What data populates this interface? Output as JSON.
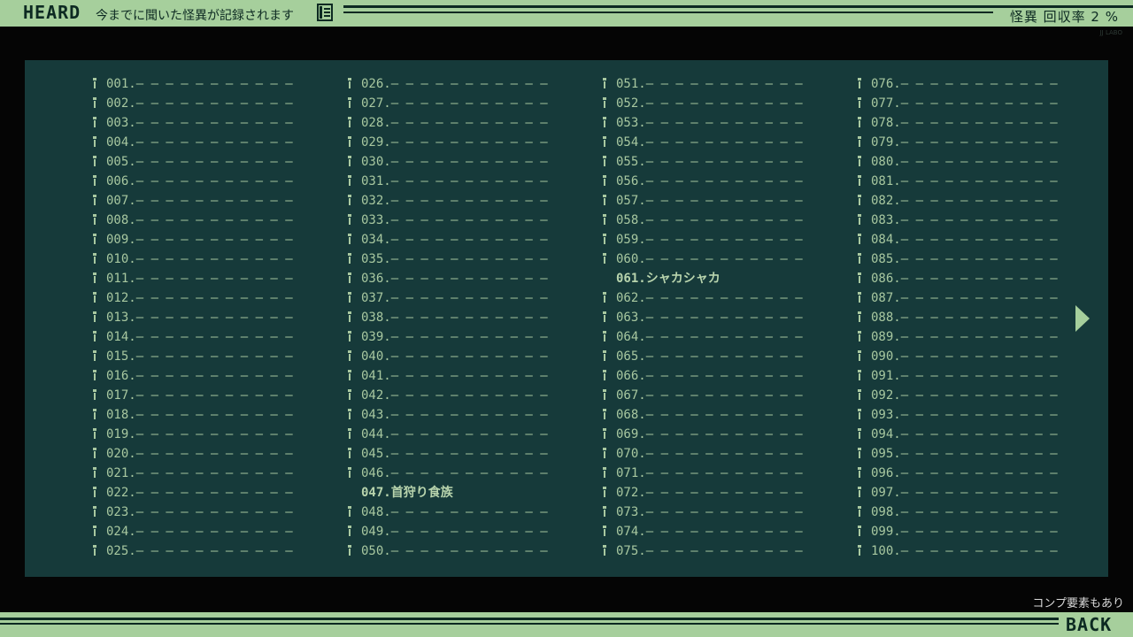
{
  "header": {
    "title": "HEARD",
    "subtitle": "今までに聞いた怪異が記録されます",
    "icon": "document-icon",
    "rate_label": "怪異 回収率 2 %"
  },
  "studio_credit": "JJ LABO",
  "colors": {
    "bar": "#a6cf9c",
    "panel": "#163a3a",
    "text": "#a8c8a0",
    "dark": "#0d2a22"
  },
  "entries": [
    {
      "num": "001.",
      "name": "",
      "locked": true
    },
    {
      "num": "002.",
      "name": "",
      "locked": true
    },
    {
      "num": "003.",
      "name": "",
      "locked": true
    },
    {
      "num": "004.",
      "name": "",
      "locked": true
    },
    {
      "num": "005.",
      "name": "",
      "locked": true
    },
    {
      "num": "006.",
      "name": "",
      "locked": true
    },
    {
      "num": "007.",
      "name": "",
      "locked": true
    },
    {
      "num": "008.",
      "name": "",
      "locked": true
    },
    {
      "num": "009.",
      "name": "",
      "locked": true
    },
    {
      "num": "010.",
      "name": "",
      "locked": true
    },
    {
      "num": "011.",
      "name": "",
      "locked": true
    },
    {
      "num": "012.",
      "name": "",
      "locked": true
    },
    {
      "num": "013.",
      "name": "",
      "locked": true
    },
    {
      "num": "014.",
      "name": "",
      "locked": true
    },
    {
      "num": "015.",
      "name": "",
      "locked": true
    },
    {
      "num": "016.",
      "name": "",
      "locked": true
    },
    {
      "num": "017.",
      "name": "",
      "locked": true
    },
    {
      "num": "018.",
      "name": "",
      "locked": true
    },
    {
      "num": "019.",
      "name": "",
      "locked": true
    },
    {
      "num": "020.",
      "name": "",
      "locked": true
    },
    {
      "num": "021.",
      "name": "",
      "locked": true
    },
    {
      "num": "022.",
      "name": "",
      "locked": true
    },
    {
      "num": "023.",
      "name": "",
      "locked": true
    },
    {
      "num": "024.",
      "name": "",
      "locked": true
    },
    {
      "num": "025.",
      "name": "",
      "locked": true
    },
    {
      "num": "026.",
      "name": "",
      "locked": true
    },
    {
      "num": "027.",
      "name": "",
      "locked": true
    },
    {
      "num": "028.",
      "name": "",
      "locked": true
    },
    {
      "num": "029.",
      "name": "",
      "locked": true
    },
    {
      "num": "030.",
      "name": "",
      "locked": true
    },
    {
      "num": "031.",
      "name": "",
      "locked": true
    },
    {
      "num": "032.",
      "name": "",
      "locked": true
    },
    {
      "num": "033.",
      "name": "",
      "locked": true
    },
    {
      "num": "034.",
      "name": "",
      "locked": true
    },
    {
      "num": "035.",
      "name": "",
      "locked": true
    },
    {
      "num": "036.",
      "name": "",
      "locked": true
    },
    {
      "num": "037.",
      "name": "",
      "locked": true
    },
    {
      "num": "038.",
      "name": "",
      "locked": true
    },
    {
      "num": "039.",
      "name": "",
      "locked": true
    },
    {
      "num": "040.",
      "name": "",
      "locked": true
    },
    {
      "num": "041.",
      "name": "",
      "locked": true
    },
    {
      "num": "042.",
      "name": "",
      "locked": true
    },
    {
      "num": "043.",
      "name": "",
      "locked": true
    },
    {
      "num": "044.",
      "name": "",
      "locked": true
    },
    {
      "num": "045.",
      "name": "",
      "locked": true
    },
    {
      "num": "046.",
      "name": "",
      "locked": true
    },
    {
      "num": "047.",
      "name": "首狩り食族",
      "locked": false
    },
    {
      "num": "048.",
      "name": "",
      "locked": true
    },
    {
      "num": "049.",
      "name": "",
      "locked": true
    },
    {
      "num": "050.",
      "name": "",
      "locked": true
    },
    {
      "num": "051.",
      "name": "",
      "locked": true
    },
    {
      "num": "052.",
      "name": "",
      "locked": true
    },
    {
      "num": "053.",
      "name": "",
      "locked": true
    },
    {
      "num": "054.",
      "name": "",
      "locked": true
    },
    {
      "num": "055.",
      "name": "",
      "locked": true
    },
    {
      "num": "056.",
      "name": "",
      "locked": true
    },
    {
      "num": "057.",
      "name": "",
      "locked": true
    },
    {
      "num": "058.",
      "name": "",
      "locked": true
    },
    {
      "num": "059.",
      "name": "",
      "locked": true
    },
    {
      "num": "060.",
      "name": "",
      "locked": true
    },
    {
      "num": "061.",
      "name": "シャカシャカ",
      "locked": false
    },
    {
      "num": "062.",
      "name": "",
      "locked": true
    },
    {
      "num": "063.",
      "name": "",
      "locked": true
    },
    {
      "num": "064.",
      "name": "",
      "locked": true
    },
    {
      "num": "065.",
      "name": "",
      "locked": true
    },
    {
      "num": "066.",
      "name": "",
      "locked": true
    },
    {
      "num": "067.",
      "name": "",
      "locked": true
    },
    {
      "num": "068.",
      "name": "",
      "locked": true
    },
    {
      "num": "069.",
      "name": "",
      "locked": true
    },
    {
      "num": "070.",
      "name": "",
      "locked": true
    },
    {
      "num": "071.",
      "name": "",
      "locked": true
    },
    {
      "num": "072.",
      "name": "",
      "locked": true
    },
    {
      "num": "073.",
      "name": "",
      "locked": true
    },
    {
      "num": "074.",
      "name": "",
      "locked": true
    },
    {
      "num": "075.",
      "name": "",
      "locked": true
    },
    {
      "num": "076.",
      "name": "",
      "locked": true
    },
    {
      "num": "077.",
      "name": "",
      "locked": true
    },
    {
      "num": "078.",
      "name": "",
      "locked": true
    },
    {
      "num": "079.",
      "name": "",
      "locked": true
    },
    {
      "num": "080.",
      "name": "",
      "locked": true
    },
    {
      "num": "081.",
      "name": "",
      "locked": true
    },
    {
      "num": "082.",
      "name": "",
      "locked": true
    },
    {
      "num": "083.",
      "name": "",
      "locked": true
    },
    {
      "num": "084.",
      "name": "",
      "locked": true
    },
    {
      "num": "085.",
      "name": "",
      "locked": true
    },
    {
      "num": "086.",
      "name": "",
      "locked": true
    },
    {
      "num": "087.",
      "name": "",
      "locked": true
    },
    {
      "num": "088.",
      "name": "",
      "locked": true
    },
    {
      "num": "089.",
      "name": "",
      "locked": true
    },
    {
      "num": "090.",
      "name": "",
      "locked": true
    },
    {
      "num": "091.",
      "name": "",
      "locked": true
    },
    {
      "num": "092.",
      "name": "",
      "locked": true
    },
    {
      "num": "093.",
      "name": "",
      "locked": true
    },
    {
      "num": "094.",
      "name": "",
      "locked": true
    },
    {
      "num": "095.",
      "name": "",
      "locked": true
    },
    {
      "num": "096.",
      "name": "",
      "locked": true
    },
    {
      "num": "097.",
      "name": "",
      "locked": true
    },
    {
      "num": "098.",
      "name": "",
      "locked": true
    },
    {
      "num": "099.",
      "name": "",
      "locked": true
    },
    {
      "num": "100.",
      "name": "",
      "locked": true
    }
  ],
  "locked_placeholder": "– – – – – – – – – – –",
  "locked_icon": "pencil-icon",
  "next_icon": "right-arrow-icon",
  "footer": {
    "comp_note": "コンプ要素もあり",
    "back_label": "BACK"
  }
}
